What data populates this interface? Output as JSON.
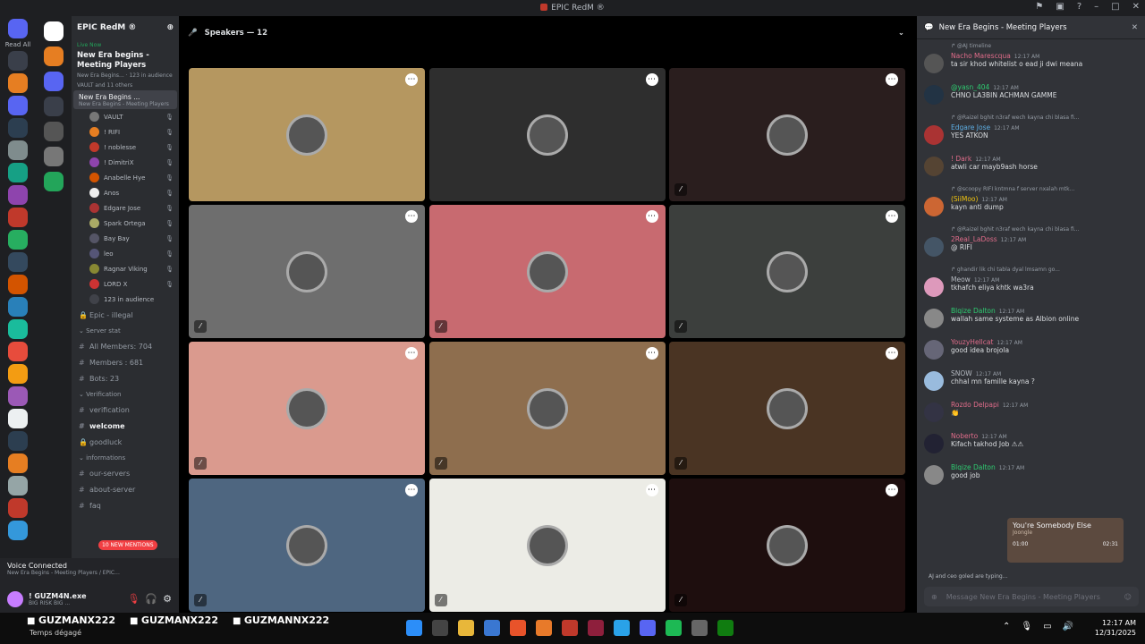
{
  "window": {
    "title": "EPIC RedM ®"
  },
  "rail": {
    "read_all": "Read All"
  },
  "server": {
    "name": "EPIC RedM ®",
    "live_now": "Live Now",
    "event_title": "New Era begins - Meeting Players",
    "event_sub": "New Era Begins... · 123 in audience",
    "event_members": "VAULT and 11 others",
    "stage_channel": "New Era Begins ...",
    "stage_channel_sub": "New Era Begins - Meeting Players",
    "members": [
      "VAULT",
      "! RIFI",
      "! noblesse",
      "! DimitriX",
      "Anabelle Hye",
      "Anos",
      "Edgare Jose",
      "Spark Ortega",
      "Bay Bay",
      "leo",
      "Ragnar Viking",
      "LORD X"
    ],
    "audience": "123 in audience",
    "channels": [
      {
        "type": "lock",
        "name": "Epic - illegal",
        "bold": false
      },
      {
        "type": "cat",
        "name": "Server stat"
      },
      {
        "type": "hash",
        "name": "All Members: 704",
        "bold": false
      },
      {
        "type": "hash",
        "name": "Members : 681",
        "bold": false
      },
      {
        "type": "hash",
        "name": "Bots: 23",
        "bold": false
      },
      {
        "type": "cat",
        "name": "Verification"
      },
      {
        "type": "hash",
        "name": "verification",
        "bold": false
      },
      {
        "type": "hash",
        "name": "welcome",
        "bold": true
      },
      {
        "type": "lock",
        "name": "goodluck",
        "bold": false
      },
      {
        "type": "cat",
        "name": "informations"
      },
      {
        "type": "hash",
        "name": "our-servers",
        "bold": false
      },
      {
        "type": "hash",
        "name": "about-server",
        "bold": false
      },
      {
        "type": "hash",
        "name": "faq",
        "bold": false
      }
    ],
    "new_mentions": "10 NEW MENTIONS"
  },
  "voice": {
    "status": "Voice Connected",
    "channel": "New Era Begins - Meeting Players / EPIC..."
  },
  "user": {
    "name": "! GUZM4N.exe",
    "status": "BIG RISK BIG ..."
  },
  "stage": {
    "speakers_label": "Speakers — 12",
    "tiles": [
      {
        "bg": "#b59760",
        "muted": false
      },
      {
        "bg": "#2e2e2e",
        "muted": false
      },
      {
        "bg": "#2a1e1e",
        "muted": true
      },
      {
        "bg": "#6e6e6e",
        "muted": true
      },
      {
        "bg": "#c86a70",
        "muted": true
      },
      {
        "bg": "#3c3f3d",
        "muted": true
      },
      {
        "bg": "#da9a8e",
        "muted": true
      },
      {
        "bg": "#8e6e4e",
        "muted": true
      },
      {
        "bg": "#4a3423",
        "muted": true
      },
      {
        "bg": "#4e6680",
        "muted": true
      },
      {
        "bg": "#ecece6",
        "muted": true
      },
      {
        "bg": "#1e0e0e",
        "muted": true
      }
    ]
  },
  "chat": {
    "title": "New Era Begins - Meeting Players",
    "messages": [
      {
        "reply": "@AJ timeline",
        "name": "Nacho Marescqua",
        "color": "#e06c8a",
        "time": "12:17 AM",
        "text": "ta sir khod whitelist o ead ji dwi meana",
        "avatar": "#555"
      },
      {
        "reply": "",
        "name": "@yasn_404",
        "color": "#2ecc71",
        "time": "12:17 AM",
        "text": "CHNO LA3BIN ACHMAN GAMME",
        "avatar": "#234"
      },
      {
        "reply": "@Raizel bghit n3raf wech kayna chi blasa fi...",
        "name": "Edgare Jose",
        "color": "#5dade2",
        "time": "12:17 AM",
        "text": "YES ATKON",
        "avatar": "#a33"
      },
      {
        "reply": "",
        "name": "! Dark",
        "color": "#e06c8a",
        "time": "12:17 AM",
        "text": "atwli car mayb9ash horse",
        "avatar": "#543"
      },
      {
        "reply": "@scoopy RIFI kntmna f server nxalah mtk...",
        "name": "(SiiMoo)",
        "color": "#f1c40f",
        "time": "12:17 AM",
        "text": "kayn anti dump",
        "avatar": "#c63"
      },
      {
        "reply": "@Raizel bghit n3raf wech kayna chi blasa fi...",
        "name": "2Real_LaDoss",
        "color": "#e06c8a",
        "time": "12:17 AM",
        "text": "@ RIFI",
        "avatar": "#456"
      },
      {
        "reply": "ghandir lik chi tabla dyal lmsamn go...",
        "name": "Meow",
        "color": "#b5bac1",
        "time": "12:17 AM",
        "text": "tkhafch eliya khtk wa3ra",
        "avatar": "#d9b"
      },
      {
        "reply": "",
        "name": "Blqize Dalton",
        "color": "#2ecc71",
        "time": "12:17 AM",
        "text": "wallah same systeme as Albion online",
        "avatar": "#888"
      },
      {
        "reply": "",
        "name": "YouzyHellcat",
        "color": "#e06c8a",
        "time": "12:17 AM",
        "text": "good idea brojola",
        "avatar": "#667"
      },
      {
        "reply": "",
        "name": "SNOW",
        "color": "#b5bac1",
        "time": "12:17 AM",
        "text": "chhal mn famille kayna ?",
        "avatar": "#9bd"
      },
      {
        "reply": "",
        "name": "Rozdo Delpapi",
        "color": "#e06c8a",
        "time": "12:17 AM",
        "text": "👏",
        "avatar": "#334"
      },
      {
        "reply": "",
        "name": "Noberto",
        "color": "#e06c8a",
        "time": "12:17 AM",
        "text": "Kifach takhod Job ⚠⚠",
        "avatar": "#223"
      },
      {
        "reply": "",
        "name": "Blqize Dalton",
        "color": "#2ecc71",
        "time": "12:17 AM",
        "text": "good job",
        "avatar": "#888"
      }
    ],
    "popup": {
      "title": "You're Somebody Else",
      "artist": "Joongle",
      "start": "01:00",
      "end": "02:31"
    },
    "typing": "AJ and ceo goled are typing...",
    "placeholder": "Message New Era Begins - Meeting Players"
  },
  "taskbar": {
    "streams": [
      "GUZMANX222",
      "GUZMANX222",
      "GUZMANNX222"
    ],
    "weather": "Temps dégagé",
    "time": "12:17 AM",
    "date": "12/31/2025"
  }
}
